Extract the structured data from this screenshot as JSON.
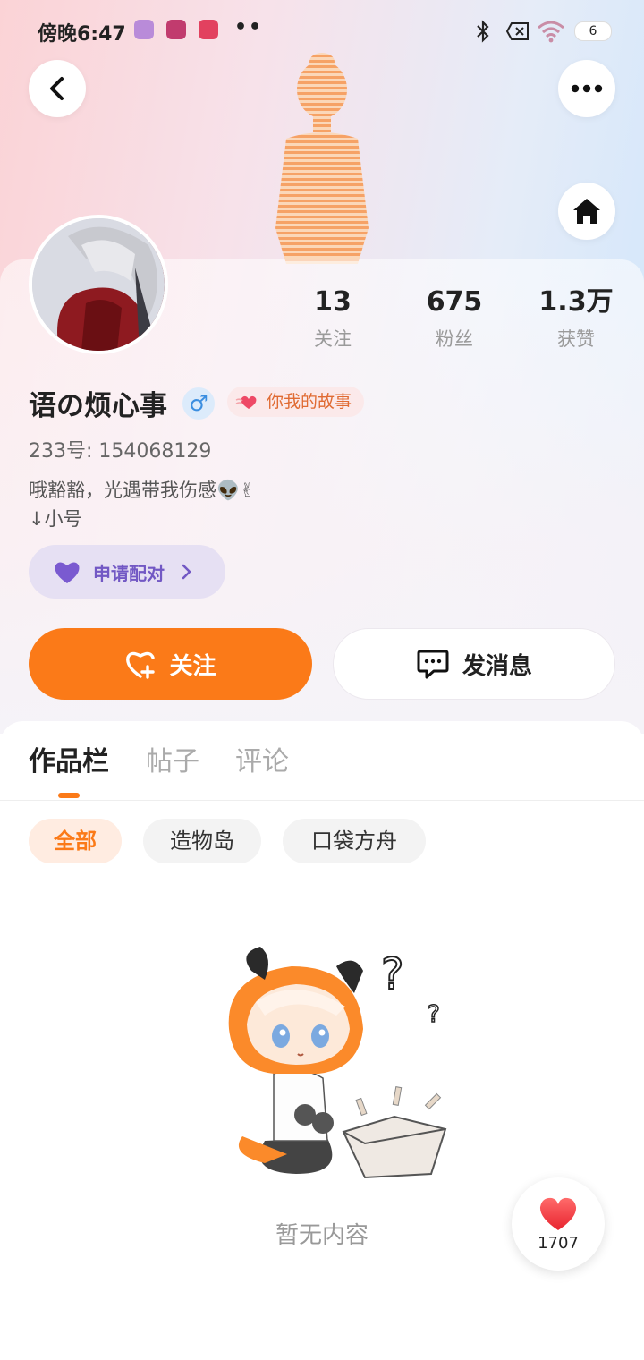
{
  "status_bar": {
    "time": "傍晚6:47",
    "dots": "••",
    "battery": "6"
  },
  "profile": {
    "username": "语の烦心事",
    "gender_symbol": "♂",
    "tag": "你我的故事",
    "uid_label": "233号: 154068129",
    "bio_line1": "哦豁豁，光遇带我伤感👽✌",
    "bio_line2": "↓小号",
    "pair_button": "申请配对"
  },
  "stats": [
    {
      "value": "13",
      "label": "关注"
    },
    {
      "value": "675",
      "label": "粉丝"
    },
    {
      "value": "1.3万",
      "label": "获赞"
    }
  ],
  "actions": {
    "follow": "关注",
    "message": "发消息"
  },
  "tabs": [
    {
      "label": "作品栏",
      "active": true
    },
    {
      "label": "帖子",
      "active": false
    },
    {
      "label": "评论",
      "active": false
    }
  ],
  "filters": [
    {
      "label": "全部",
      "active": true
    },
    {
      "label": "造物岛",
      "active": false
    },
    {
      "label": "口袋方舟",
      "active": false
    }
  ],
  "empty_state": {
    "text": "暂无内容"
  },
  "like_fab": {
    "count": "1707"
  },
  "colors": {
    "accent": "#fb7a18",
    "pair": "#7258c4"
  }
}
